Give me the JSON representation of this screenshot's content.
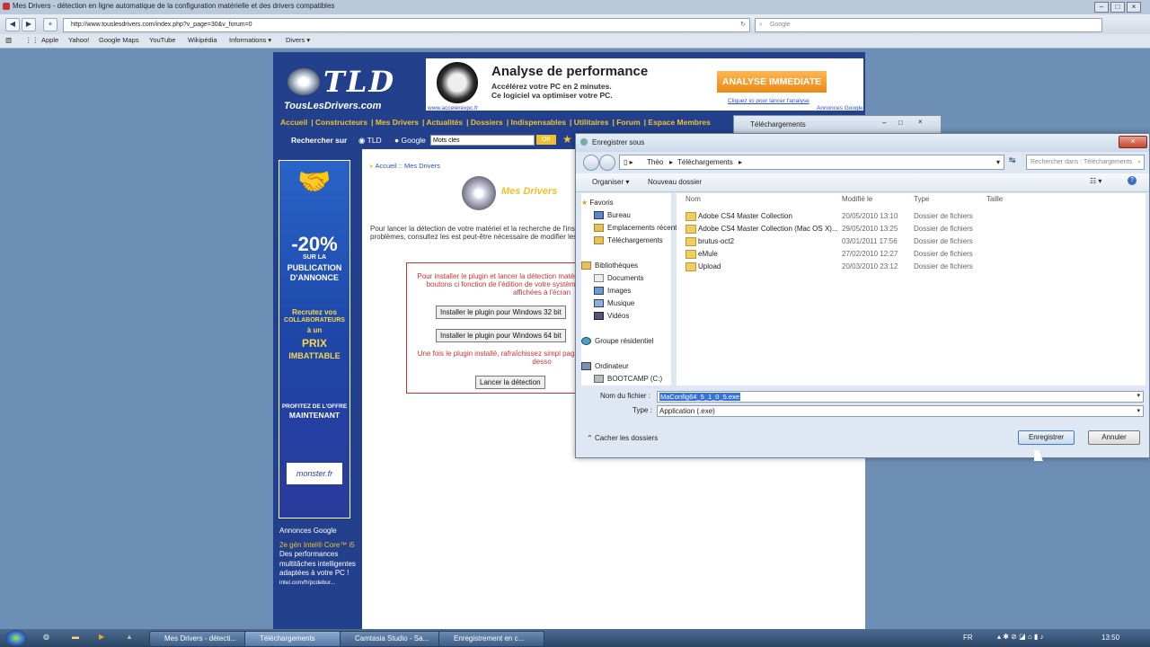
{
  "browser": {
    "title": "Mes Drivers - détection en ligne automatique de la configuration matérielle et des drivers compatibles",
    "url": "http://www.touslesdrivers.com/index.php?v_page=30&v_forum=0",
    "search_placeholder": "Google",
    "bookmarks": [
      "Apple",
      "Yahoo!",
      "Google Maps",
      "YouTube",
      "Wikipédia",
      "Informations ▾",
      "Divers ▾"
    ]
  },
  "site": {
    "logo_main": "TLD",
    "logo_sub": "TousLesDrivers.com",
    "banner": {
      "headline": "Analyse de performance",
      "line1": "Accélérez votre PC en 2 minutes.",
      "line2": "Ce logiciel va optimiser votre PC.",
      "cta": "ANALYSE IMMEDIATE",
      "link": "Cliquez ici pour lancer l'analyse",
      "sponsor": "www.accelerexpc.fr",
      "ads_label": "Annonces Google"
    },
    "menu": [
      "Accueil",
      "Constructeurs",
      "Mes Drivers",
      "Actualités",
      "Dossiers",
      "Indispensables",
      "Utilitaires",
      "Forum",
      "Espace Membres"
    ],
    "search": {
      "label": "Rechercher sur",
      "opt1": "TLD",
      "opt2": "Google",
      "value": "Mots clés",
      "ok": "OK"
    },
    "breadcrumb": "Accueil :: Mes Drivers",
    "section_title": "Mes Drivers",
    "intro": "Pour lancer la détection de votre matériel et la recherche de l'installation du plugin. En cas de problèmes, consultez les est peut-être nécessaire de modifier les paramètres de votr",
    "plugin_notice": "Pour installer le plugin et lancer la détection matériel, cliquez sur l'un des deux boutons ci fonction de l'édition de votre système d'exploit les instructions affichées à l'écran",
    "btn_32": "Installer le plugin pour Windows 32 bit",
    "btn_64": "Installer le plugin pour Windows 64 bit",
    "after_install": "Une fois le plugin installé, rafraîchissez simpl page ou cliquez sur le bouton ci-desso",
    "btn_detect": "Lancer la détection",
    "promo": {
      "pct": "-20%",
      "l1": "SUR LA",
      "l2": "PUBLICATION",
      "l3": "D'ANNONCE",
      "l4": "Recrutez vos",
      "l5": "COLLABORATEURS",
      "l6": "à un",
      "l7": "PRIX",
      "l8": "IMBATTABLE",
      "l9": "PROFITEZ DE L'OFFRE",
      "l10": "MAINTENANT",
      "brand": "monster.fr"
    },
    "ads": {
      "header": "Annonces Google",
      "title": "2e gén Intel® Core™ i5",
      "body": "Des performances multitâches intelligentes adaptées à votre PC !",
      "url": "intel.com/fr/pcdebur..."
    }
  },
  "bg_window": {
    "title": "Téléchargements"
  },
  "dialog": {
    "title": "Enregistrer sous",
    "path": [
      "Théo",
      "Téléchargements"
    ],
    "search_placeholder": "Rechercher dans : Téléchargements",
    "organize": "Organiser ▾",
    "new_folder": "Nouveau dossier",
    "nav": [
      {
        "label": "Favoris",
        "indent": false
      },
      {
        "label": "Bureau",
        "indent": true
      },
      {
        "label": "Emplacements récents",
        "indent": true
      },
      {
        "label": "Téléchargements",
        "indent": true
      },
      {
        "label": "Bibliothèques",
        "indent": false
      },
      {
        "label": "Documents",
        "indent": true
      },
      {
        "label": "Images",
        "indent": true
      },
      {
        "label": "Musique",
        "indent": true
      },
      {
        "label": "Vidéos",
        "indent": true
      },
      {
        "label": "Groupe résidentiel",
        "indent": false
      },
      {
        "label": "Ordinateur",
        "indent": false
      },
      {
        "label": "BOOTCAMP (C:)",
        "indent": true
      }
    ],
    "columns": [
      "Nom",
      "Modifié le",
      "Type",
      "Taille"
    ],
    "files": [
      {
        "name": "Adobe CS4 Master Collection",
        "date": "20/05/2010 13:10",
        "type": "Dossier de fichiers"
      },
      {
        "name": "Adobe CS4 Master Collection (Mac OS X)...",
        "date": "29/05/2010 13:25",
        "type": "Dossier de fichiers"
      },
      {
        "name": "brutus-oct2",
        "date": "03/01/2011 17:56",
        "type": "Dossier de fichiers"
      },
      {
        "name": "eMule",
        "date": "27/02/2010 12:27",
        "type": "Dossier de fichiers"
      },
      {
        "name": "Upload",
        "date": "20/03/2010 23:12",
        "type": "Dossier de fichiers"
      }
    ],
    "filename_label": "Nom du fichier :",
    "filename": "MaConfig64_5_1_0_5.exe",
    "type_label": "Type :",
    "type_value": "Application (.exe)",
    "hide_folders": "Cacher les dossiers",
    "save": "Enregistrer",
    "cancel": "Annuler"
  },
  "taskbar": {
    "items": [
      "Mes Drivers - détecti...",
      "Téléchargements",
      "Camtasia Studio - Sa...",
      "Enregistrement en c..."
    ],
    "lang": "FR",
    "clock": "13:50"
  }
}
